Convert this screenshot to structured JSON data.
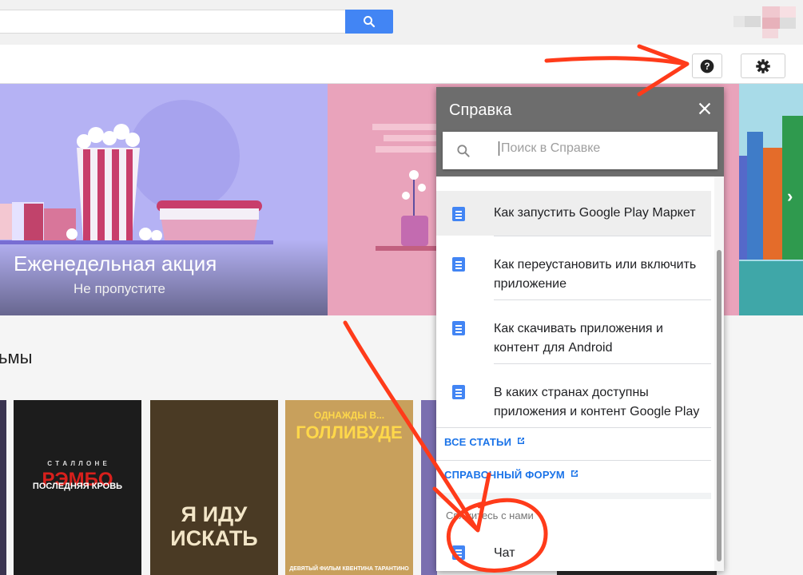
{
  "header": {
    "search_placeholder": ""
  },
  "banner": {
    "title": "Еженедельная акция",
    "subtitle": "Не пропустите",
    "next_arrow": "›"
  },
  "section": {
    "title": "ьмы"
  },
  "posters": [
    {
      "title_top": "С Т А Л Л О Н Е",
      "title": "РЭМБО",
      "subtitle": "ПОСЛЕДНЯЯ КРОВЬ"
    },
    {
      "title": "Я ИДУ ИСКАТЬ"
    },
    {
      "title_top": "ОДНАЖДЫ В...",
      "title": "ГОЛЛИВУДЕ",
      "caption": "ДЕВЯТЫЙ ФИЛЬМ КВЕНТИНА ТАРАНТИНО"
    }
  ],
  "help": {
    "title": "Справка",
    "search_placeholder": "Поиск в Справке",
    "articles": [
      {
        "label": "Как запустить Google Play Маркет"
      },
      {
        "label": "Как переустановить или включить приложение"
      },
      {
        "label": "Как скачивать приложения и контент для Android"
      },
      {
        "label": "В каких странах доступны приложения и контент Google Play"
      }
    ],
    "all_articles": "ВСЕ СТАТЬИ",
    "forum": "СПРАВОЧНЫЙ ФОРУМ",
    "contact_heading": "Свяжитесь с нами",
    "chat": "Чат"
  },
  "colors": {
    "accent": "#4285f4",
    "header_gray": "#6d6d6d",
    "link": "#1a73e8",
    "annotation": "#ff3b1a"
  }
}
